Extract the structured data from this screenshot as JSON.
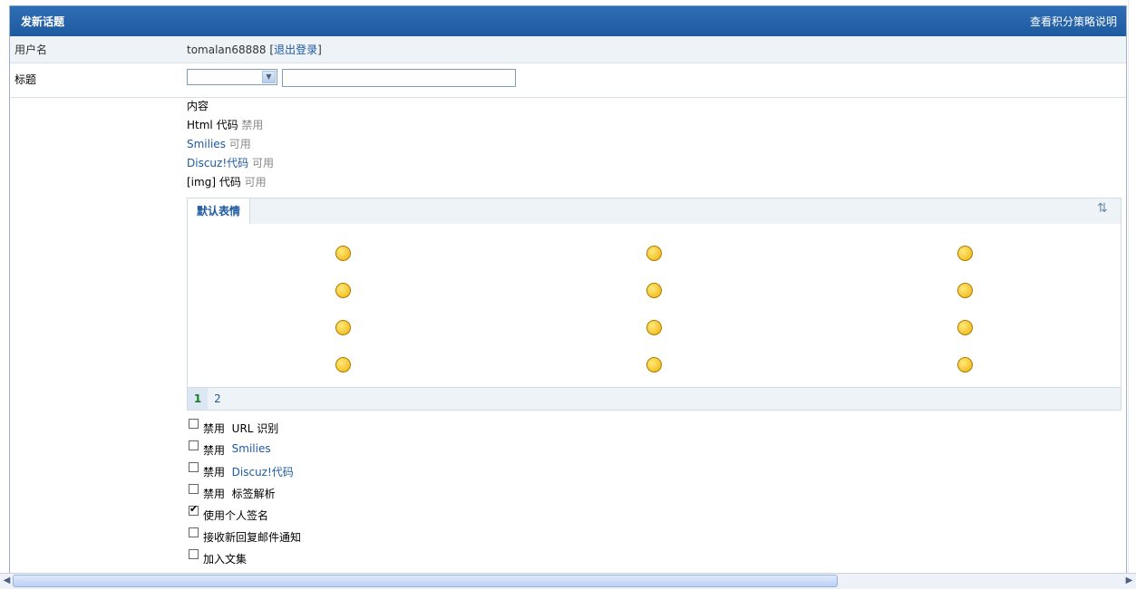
{
  "header": {
    "title": "发新话题",
    "link": "查看积分策略说明"
  },
  "user_row": {
    "label": "用户名",
    "username": "tomalan68888",
    "logout_open": "[",
    "logout": "退出登录",
    "logout_close": "]"
  },
  "title_row": {
    "label": "标题",
    "type_select_value": "",
    "title_value": ""
  },
  "content": {
    "label": "内容",
    "options": [
      {
        "name": "Html 代码",
        "status": "禁用",
        "link": false
      },
      {
        "name": "Smilies",
        "status": "可用",
        "link": true
      },
      {
        "name": "Discuz!代码",
        "status": "可用",
        "link": true
      },
      {
        "name": "[img] 代码",
        "status": "可用",
        "link": false
      }
    ]
  },
  "smilies": {
    "tab": "默认表情",
    "toggle_icon": "collapse-toggle-icon",
    "icons": [
      "smile-icon",
      "handshake-icon",
      "lips-icon",
      "clock-icon",
      "victory-hand-icon",
      "person-icon",
      "grin-icon",
      "frown-icon",
      "wink-tongue-icon",
      "drool-icon",
      "sly-icon",
      "tongue-icon"
    ],
    "pages": [
      "1",
      "2"
    ],
    "active_page": "1"
  },
  "checkboxes": [
    {
      "prefix": "禁用",
      "label": "URL 识别",
      "blue": false,
      "checked": false
    },
    {
      "prefix": "禁用",
      "label": "Smilies",
      "blue": true,
      "checked": false
    },
    {
      "prefix": "禁用",
      "label": "Discuz!代码",
      "blue": true,
      "checked": false
    },
    {
      "prefix": "禁用",
      "label": "标签解析",
      "blue": false,
      "checked": false
    },
    {
      "prefix": "",
      "label": "使用个人签名",
      "blue": false,
      "checked": true
    },
    {
      "prefix": "",
      "label": "接收新回复邮件通知",
      "blue": false,
      "checked": false
    },
    {
      "prefix": "",
      "label": "加入文集",
      "blue": false,
      "checked": false
    }
  ]
}
